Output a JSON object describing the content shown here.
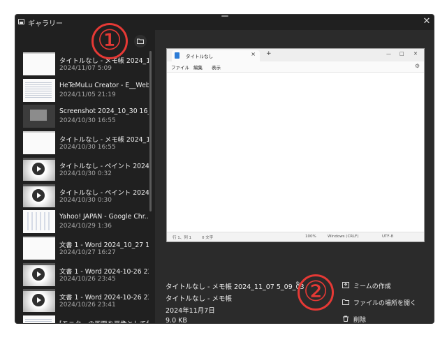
{
  "window": {
    "title": "ギャラリー",
    "close_glyph": "✕"
  },
  "gallery": {
    "items": [
      {
        "title": "タイトルなし - メモ帳 2024_11_07 5_09_03",
        "date": "2024/11/07 5:09",
        "thumb": "white"
      },
      {
        "title": "HeTeMuLu Creator - E__Web...",
        "date": "2024/11/05 21:19",
        "thumb": "doc"
      },
      {
        "title": "Screenshot 2024_10_30 16_55_...",
        "date": "2024/10/30 16:55",
        "thumb": "dark"
      },
      {
        "title": "タイトルなし - メモ帳 2024_10_30...",
        "date": "2024/10/30 16:55",
        "thumb": "white"
      },
      {
        "title": "タイトルなし - ペイント 2024-10-...",
        "date": "2024/10/30 0:32",
        "thumb": "video"
      },
      {
        "title": "タイトルなし - ペイント 2024-10-...",
        "date": "2024/10/30 0:30",
        "thumb": "video"
      },
      {
        "title": "Yahoo! JAPAN - Google Chr...",
        "date": "2024/10/29 1:36",
        "thumb": "yahoo"
      },
      {
        "title": "文書 1 - Word 2024_10_27 16...",
        "date": "2024/10/27 16:27",
        "thumb": "white"
      },
      {
        "title": "文書 1 - Word 2024-10-26 23...",
        "date": "2024/10/26 23:45",
        "thumb": "video"
      },
      {
        "title": "文書 1 - Word 2024-10-26 23...",
        "date": "2024/10/26 23:41",
        "thumb": "video"
      },
      {
        "title": "[モニターの画面を画像として保...",
        "date": "",
        "thumb": "doc"
      }
    ]
  },
  "preview": {
    "tab_label": "タイトルなし",
    "tab_close": "×",
    "new_tab": "+",
    "win_min": "—",
    "win_max": "□",
    "win_close": "✕",
    "menu": [
      "ファイル",
      "編集",
      "表示"
    ],
    "status": [
      "行 1、列 1",
      "0 文字",
      "100%",
      "Windows (CRLF)",
      "UTF-8"
    ]
  },
  "details": {
    "file_name": "タイトルなし - メモ帳 2024_11_07 5_09_03",
    "window_title": "タイトルなし - メモ帳",
    "date": "2024年11月7日",
    "size": "9.0 KB"
  },
  "actions": {
    "create_meme": "ミームの作成",
    "open_location": "ファイルの場所を開く",
    "delete": "削除"
  },
  "annotations": {
    "one": "①",
    "two": "②"
  },
  "colors": {
    "window_bg": "#202020",
    "content_bg": "#2b2b2b",
    "annotation": "#e53935"
  }
}
